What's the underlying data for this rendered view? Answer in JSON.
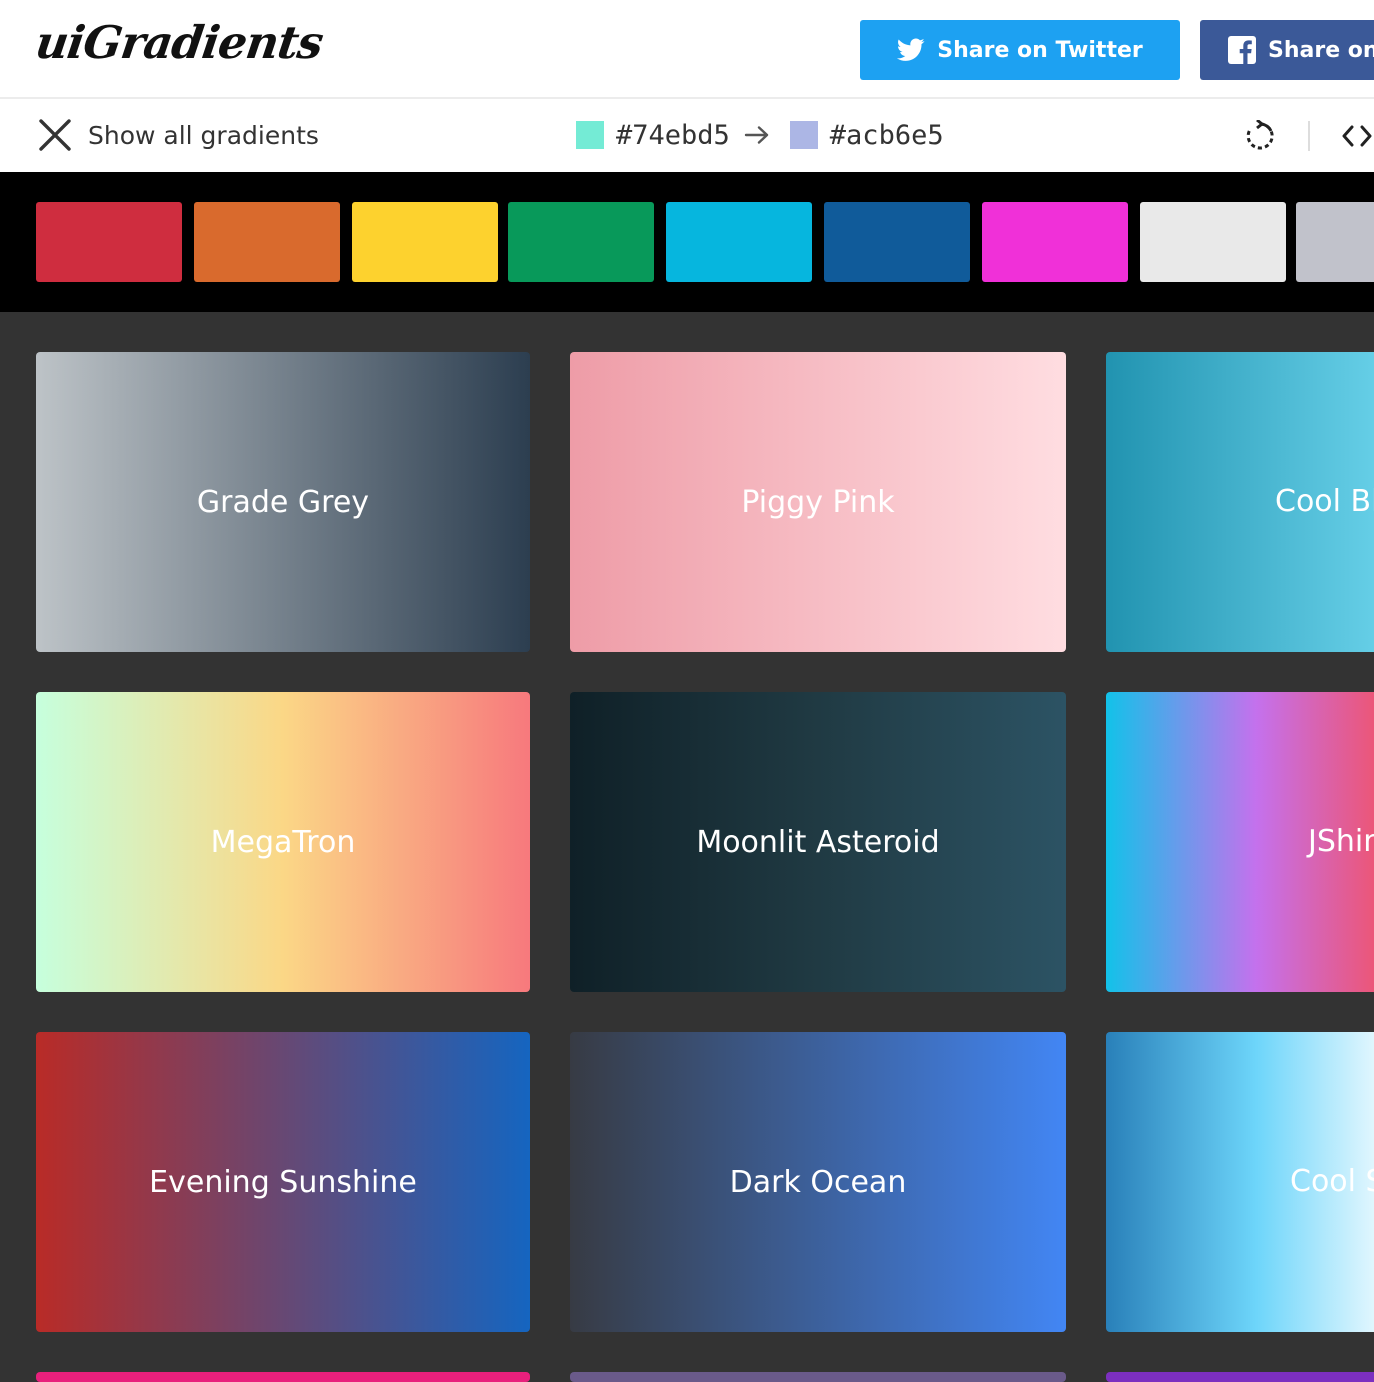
{
  "header": {
    "logo": "uiGradients",
    "share_twitter": "Share on Twitter",
    "share_facebook": "Share on Facebook",
    "icons": {
      "twitter": "twitter-bird-icon",
      "facebook": "facebook-f-icon"
    }
  },
  "display": {
    "show_all_label": "Show all gradients",
    "from_hex": "#74ebd5",
    "to_hex": "#acb6e5",
    "from_color": "#74ebd5",
    "to_color": "#acb6e5",
    "icons": {
      "close": "close-x-icon",
      "arrow": "arrow-right-icon",
      "rotate": "rotate-icon",
      "code": "code-brackets-icon"
    }
  },
  "filters": {
    "colors": [
      "#cf2d3f",
      "#d96a2d",
      "#fdd22e",
      "#08995a",
      "#06b6de",
      "#105b9a",
      "#f030d8",
      "#e9e9e9",
      "#c1c2cb"
    ]
  },
  "gradients": [
    {
      "name": "Grade Grey",
      "colors": [
        "#bdc3c7",
        "#2c3e50"
      ]
    },
    {
      "name": "Piggy Pink",
      "colors": [
        "#ee9ca7",
        "#ffdde1"
      ]
    },
    {
      "name": "Cool Blues",
      "colors": [
        "#2193b0",
        "#6dd5ed"
      ]
    },
    {
      "name": "MegaTron",
      "colors": [
        "#c6ffdd",
        "#fbd786",
        "#f7797d"
      ]
    },
    {
      "name": "Moonlit Asteroid",
      "colors": [
        "#0f2027",
        "#203a43",
        "#2c5364"
      ]
    },
    {
      "name": "JShine",
      "colors": [
        "#12c2e9",
        "#c471ed",
        "#f64f59"
      ]
    },
    {
      "name": "Evening Sunshine",
      "colors": [
        "#b92b27",
        "#1565c0"
      ]
    },
    {
      "name": "Dark Ocean",
      "colors": [
        "#373b44",
        "#4286f4"
      ]
    },
    {
      "name": "Cool Sky",
      "colors": [
        "#2980b9",
        "#6dd5fa",
        "#ffffff"
      ]
    }
  ],
  "partial_row_colors": [
    "#e8207c",
    "#6a5a8a",
    "#7c2fc0"
  ]
}
